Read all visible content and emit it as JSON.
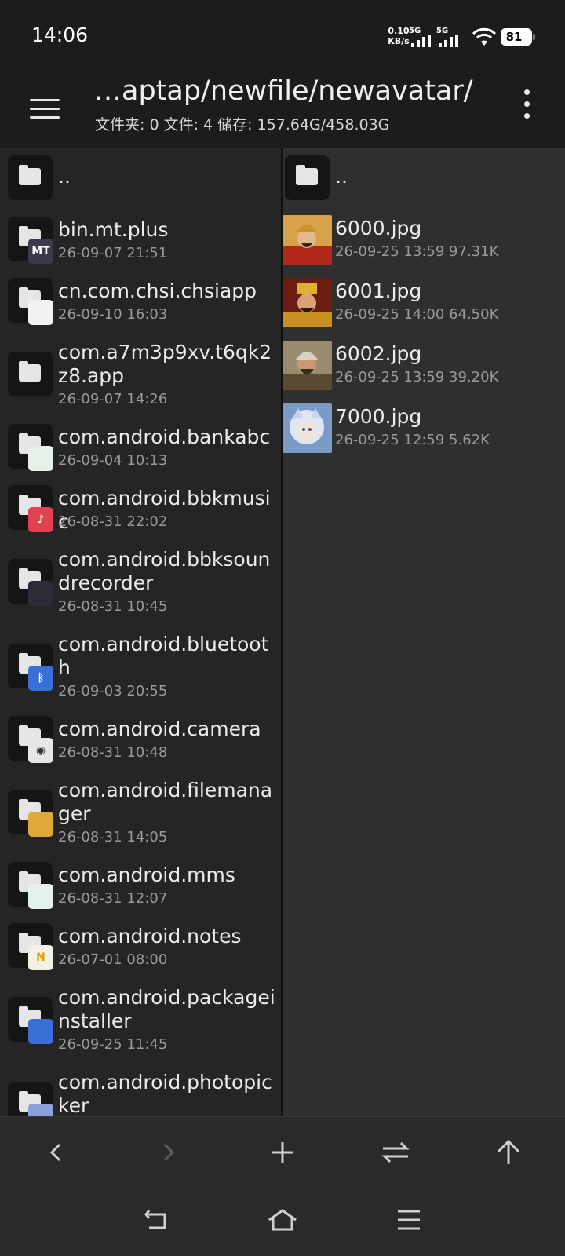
{
  "status_bar": {
    "time": "14:06",
    "net_speed_value": "0.10",
    "net_speed_unit": "KB/s",
    "sim1_label": "5G",
    "sim2_label": "5G",
    "battery": "81"
  },
  "toolbar": {
    "path": "…aptap/newfile/newavatar/",
    "info": "文件夹: 0  文件: 4  储存: 157.64G/458.03G"
  },
  "left_pane": {
    "parent_label": "..",
    "items": [
      {
        "name": "bin.mt.plus",
        "date": "26-09-07 21:51",
        "badge": "MT",
        "badge_color": "#3a3a4a",
        "icon": "mt-manager-icon"
      },
      {
        "name": "cn.com.chsi.chsiapp",
        "date": "26-09-10 16:03",
        "badge": "",
        "badge_color": "#f2f2f2",
        "icon": "chsi-bird-icon"
      },
      {
        "name": "com.a7m3p9xv.t6qk2z8.app",
        "date": "26-09-07 14:26",
        "badge": null,
        "badge_color": null,
        "icon": "folder-icon"
      },
      {
        "name": "com.android.bankabc",
        "date": "26-09-04 10:13",
        "badge": "",
        "badge_color": "#e8f0ea",
        "icon": "abc-bank-icon"
      },
      {
        "name": "com.android.bbkmusic",
        "date": "26-08-31 22:02",
        "badge": "♪",
        "badge_color": "#e0434f",
        "icon": "music-icon"
      },
      {
        "name": "com.android.bbksoundrecorder",
        "date": "26-08-31 10:45",
        "badge": "",
        "badge_color": "#2c2c38",
        "icon": "recorder-icon"
      },
      {
        "name": "com.android.bluetooth",
        "date": "26-09-03 20:55",
        "badge": "ᛒ",
        "badge_color": "#3a6fd8",
        "icon": "bluetooth-icon"
      },
      {
        "name": "com.android.camera",
        "date": "26-08-31 10:48",
        "badge": "◉",
        "badge_color": "#e6e6e6",
        "icon": "camera-icon"
      },
      {
        "name": "com.android.filemanager",
        "date": "26-08-31 14:05",
        "badge": "",
        "badge_color": "#e0a83a",
        "icon": "file-manager-icon"
      },
      {
        "name": "com.android.mms",
        "date": "26-08-31 12:07",
        "badge": "",
        "badge_color": "#e4f2ef",
        "icon": "messages-icon"
      },
      {
        "name": "com.android.notes",
        "date": "26-07-01 08:00",
        "badge": "N",
        "badge_color": "#f4f0e4",
        "icon": "notes-icon"
      },
      {
        "name": "com.android.packageinstaller",
        "date": "26-09-25 11:45",
        "badge": "",
        "badge_color": "#3a6fd8",
        "icon": "package-installer-icon"
      },
      {
        "name": "com.android.photopicker",
        "date": "",
        "badge": "",
        "badge_color": "#8aa0d8",
        "icon": "photo-picker-icon"
      }
    ]
  },
  "right_pane": {
    "parent_label": "..",
    "files": [
      {
        "name": "6000.jpg",
        "date": "26-09-25 13:59",
        "size": "97.31K"
      },
      {
        "name": "6001.jpg",
        "date": "26-09-25 14:00",
        "size": "64.50K"
      },
      {
        "name": "6002.jpg",
        "date": "26-09-25 13:59",
        "size": "39.20K"
      },
      {
        "name": "7000.jpg",
        "date": "26-09-25 12:59",
        "size": "5.62K"
      }
    ]
  },
  "action_bar": {
    "buttons": [
      "back-arrow-icon",
      "forward-arrow-icon",
      "plus-icon",
      "swap-icon",
      "up-arrow-icon"
    ]
  },
  "nav_bar": {
    "buttons": [
      "nav-back-icon",
      "nav-home-icon",
      "nav-menu-icon"
    ]
  },
  "colors": {
    "background": "#1c1c1c",
    "left_pane": "#252525",
    "right_pane": "#2f2f2f",
    "text_primary": "#ececec",
    "text_secondary": "#9a9a9a"
  }
}
